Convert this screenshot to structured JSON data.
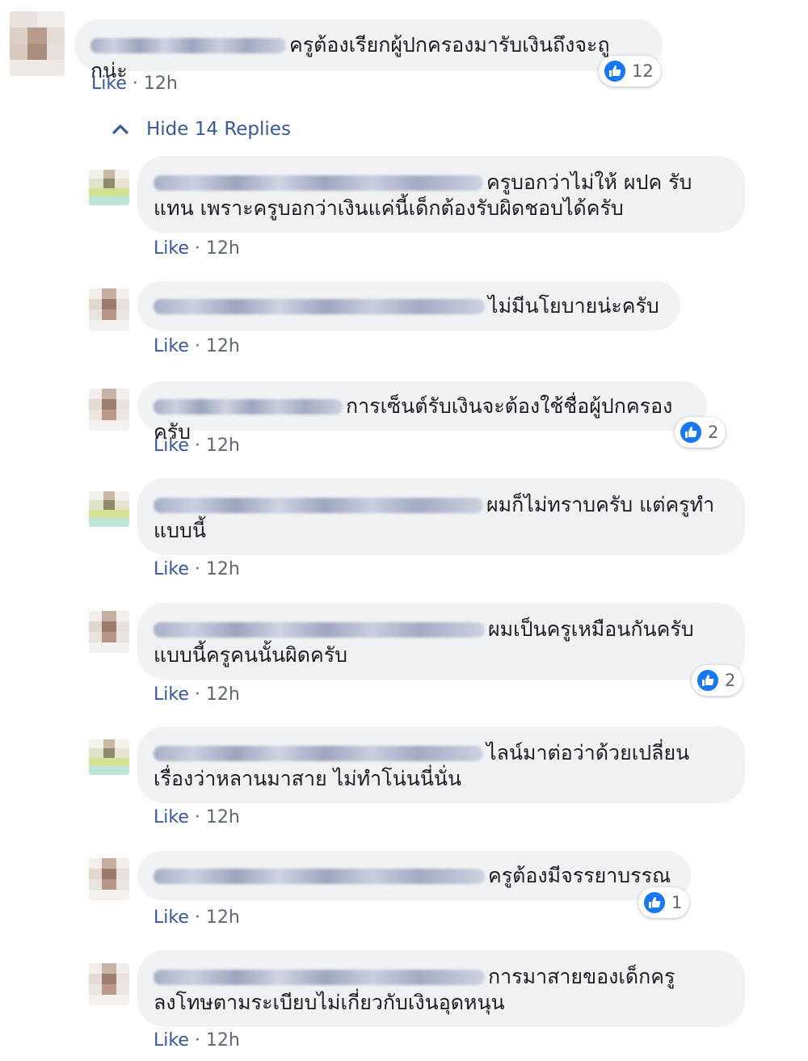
{
  "colors": {
    "link": "#385898",
    "bubble": "#f1f2f4",
    "reaction": "#1877f2",
    "muted": "#606770"
  },
  "like_label": "Like",
  "dot": "·",
  "time": "12h",
  "root": {
    "text": "ครูต้องเรียกผู้ปกครองมารับเงินถึงจะถูกน่ะ",
    "reactions": "12"
  },
  "hide_replies": "Hide 14 Replies",
  "replies": [
    {
      "line1": "ครูบอกว่าไม่ให้ ผปค รับ",
      "line2": "แทน เพราะครูบอกว่าเงินแค่นี้เด็กต้องรับผิดชอบได้ครับ",
      "reactions": ""
    },
    {
      "line1": "ไม่มีนโยบายน่ะครับ",
      "line2": "",
      "reactions": ""
    },
    {
      "line1": "การเซ็นต์รับเงินจะต้องใช้ชื่อผู้ปกครองครับ",
      "line2": "",
      "reactions": "2"
    },
    {
      "line1": "ผมก็ไม่ทราบครับ แต่ครูทำ",
      "line2": "แบบนี้",
      "reactions": ""
    },
    {
      "line1": "ผมเป็นครูเหมือนกันครับ",
      "line2": "แบบนี้ครูคนนั้นผิดครับ",
      "reactions": "2"
    },
    {
      "line1": "ไลน์มาต่อว่าด้วยเปลี่ยน",
      "line2": "เรื่องว่าหลานมาสาย ไม่ทำโน่นนี่นั่น",
      "reactions": ""
    },
    {
      "line1": "ครูต้องมีจรรยาบรรณ",
      "line2": "",
      "reactions": "1"
    },
    {
      "line1": "การมาสายของเด็กครู",
      "line2": "ลงโทษตามระเบียบไม่เกี่ยวกับเงินอุดหนุน",
      "reactions": ""
    }
  ]
}
